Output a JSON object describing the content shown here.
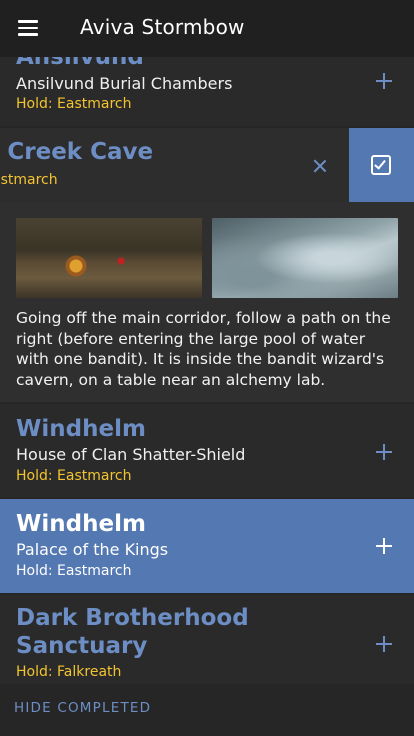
{
  "appbar": {
    "title": "Aviva Stormbow"
  },
  "items": [
    {
      "location": "Ansilvund",
      "place": "Ansilvund Burial Chambers",
      "hold": "Hold: Eastmarch"
    },
    {
      "location": "Windhelm",
      "place": "House of Clan Shatter-Shield",
      "hold": "Hold: Eastmarch"
    },
    {
      "location": "Windhelm",
      "place": "Palace of the Kings",
      "hold": "Hold: Eastmarch"
    },
    {
      "location": "Dark Brotherhood Sanctuary",
      "hold": "Hold: Falkreath"
    }
  ],
  "swiped_item": {
    "location_fragment": "ny Creek Cave",
    "hold_fragment": "astmarch"
  },
  "expanded": {
    "description": "Going off the main corridor, follow a path on the right (before entering the large pool of water with one bandit). It is inside the bandit wizard's cavern, on a table near an alchemy lab."
  },
  "footer": {
    "toggle_label": "HIDE COMPLETED"
  },
  "colors": {
    "accent": "#5478b2",
    "location_text": "#6d8ec4",
    "hold_text": "#f4c430",
    "background": "#262626"
  }
}
